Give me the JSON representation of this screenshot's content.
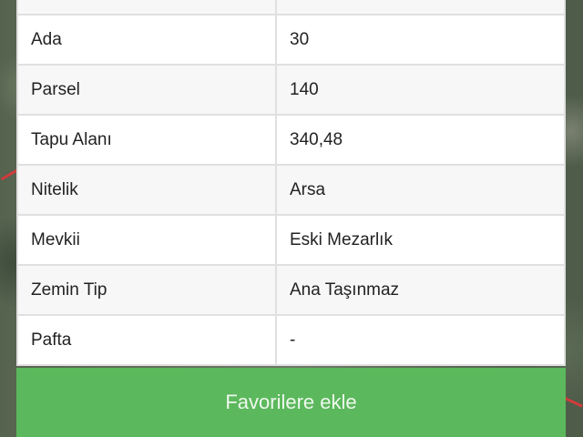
{
  "details": {
    "rows": [
      {
        "label": "",
        "value": ""
      },
      {
        "label": "Ada",
        "value": "30"
      },
      {
        "label": "Parsel",
        "value": "140"
      },
      {
        "label": "Tapu Alanı",
        "value": "340,48"
      },
      {
        "label": "Nitelik",
        "value": "Arsa"
      },
      {
        "label": "Mevkii",
        "value": "Eski Mezarlık"
      },
      {
        "label": "Zemin Tip",
        "value": "Ana Taşınmaz"
      },
      {
        "label": "Pafta",
        "value": "-"
      }
    ]
  },
  "actions": {
    "favorite_label": "Favorilere ekle",
    "favorite_color": "#5cb85c"
  }
}
